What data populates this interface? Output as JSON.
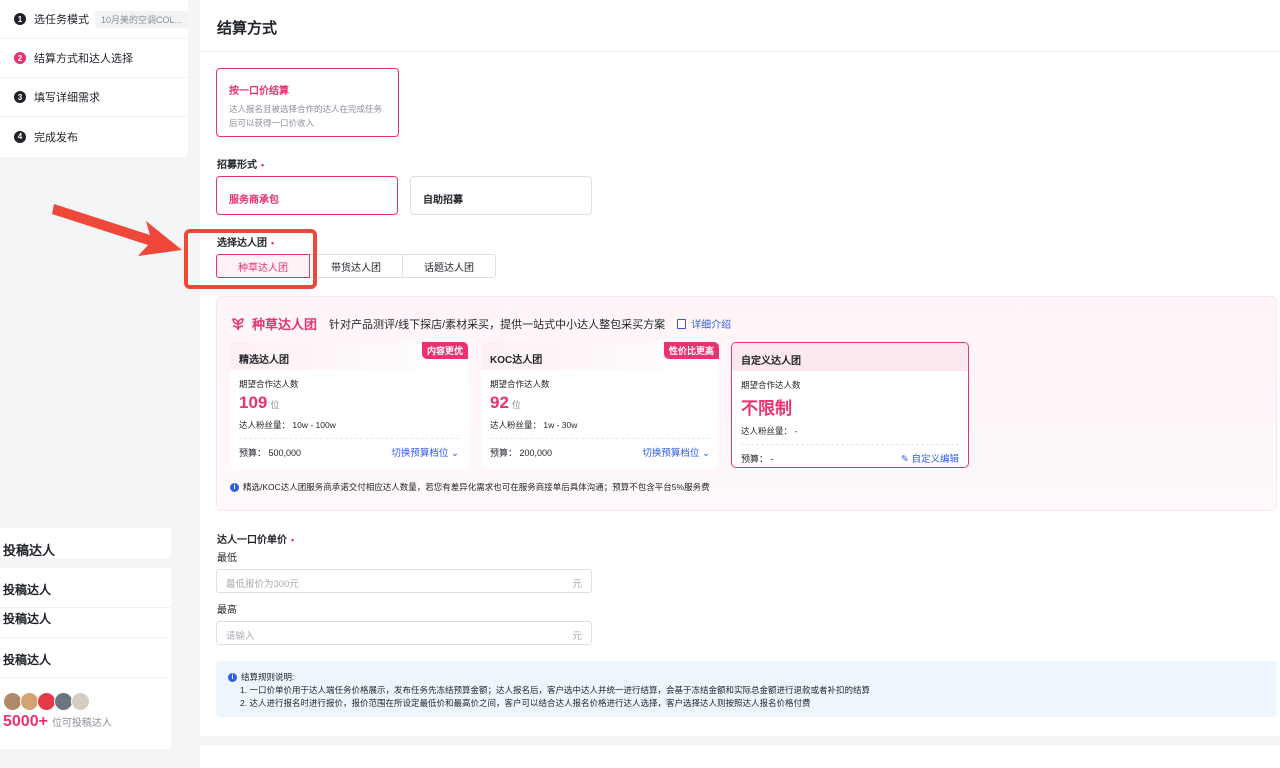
{
  "steps": [
    {
      "num": "1",
      "label": "选任务模式",
      "sub": "10月美的空调COL..."
    },
    {
      "num": "2",
      "label": "结算方式和达人选择"
    },
    {
      "num": "3",
      "label": "填写详细需求"
    },
    {
      "num": "4",
      "label": "完成发布"
    }
  ],
  "preview": {
    "top_text": "投稿达人",
    "rows": [
      "投稿达人",
      "投稿达人",
      "投稿达人"
    ],
    "count": "5000+",
    "count_suffix": "位可投稿达人",
    "avatar_colors": [
      "#b08968",
      "#d4a373",
      "#e63946",
      "#6c757d",
      "#d6ccc2"
    ]
  },
  "main": {
    "title": "结算方式",
    "settle": {
      "title": "按一口价结算",
      "desc": "达人报名且被选择合作的达人在完成任务后可以获得一口价收入"
    },
    "recruit_label": "招募形式",
    "recruit_options": [
      "服务商承包",
      "自助招募"
    ],
    "team_label": "选择达人团",
    "team_tabs": [
      "种草达人团",
      "带货达人团",
      "话题达人团"
    ],
    "panel": {
      "title": "种草达人团",
      "desc": "针对产品测评/线下探店/素材采买，提供一站式中小达人整包采买方案",
      "link": "详细介绍",
      "cards": [
        {
          "name": "精选达人团",
          "tag": "内容更优",
          "count_label": "期望合作达人数",
          "count": "109",
          "unit": "位",
          "fans": "达人粉丝量：  10w - 100w",
          "budget": "预算：  500,000",
          "action": "切换预算档位"
        },
        {
          "name": "KOC达人团",
          "tag": "性价比更高",
          "count_label": "期望合作达人数",
          "count": "92",
          "unit": "位",
          "fans": "达人粉丝量：  1w - 30w",
          "budget": "预算：  200,000",
          "action": "切换预算档位"
        },
        {
          "name": "自定义达人团",
          "count_label": "期望合作达人数",
          "count": "不限制",
          "fans": "达人粉丝量：  -",
          "budget": "预算：  -",
          "action": "自定义编辑"
        }
      ],
      "note": "精选/KOC达人团服务商承诺交付相应达人数量，若您有差异化需求也可在服务商接单后具体沟通；预算不包含平台5%服务费"
    },
    "price_label": "达人一口价单价",
    "min_label": "最低",
    "min_placeholder": "最低报价为300元",
    "max_label": "最高",
    "max_placeholder": "请输入",
    "unit": "元",
    "rules": {
      "title": "结算规则说明:",
      "lines": [
        "1. 一口价单价用于达人端任务价格展示，发布任务先冻结预算金额；达人报名后，客户选中达人并统一进行结算，会基于冻结金额和实际总金额进行退款或者补扣的结算",
        "2. 达人进行报名时进行报价，报价范围在所设定最低价和最高价之间，客户可以结合达人报名价格进行达人选择，客户选择达人则按照达人报名价格付费"
      ]
    }
  },
  "colors": {
    "accent": "#e8336e",
    "link": "#2f5bea",
    "annotation": "#f0473b"
  }
}
